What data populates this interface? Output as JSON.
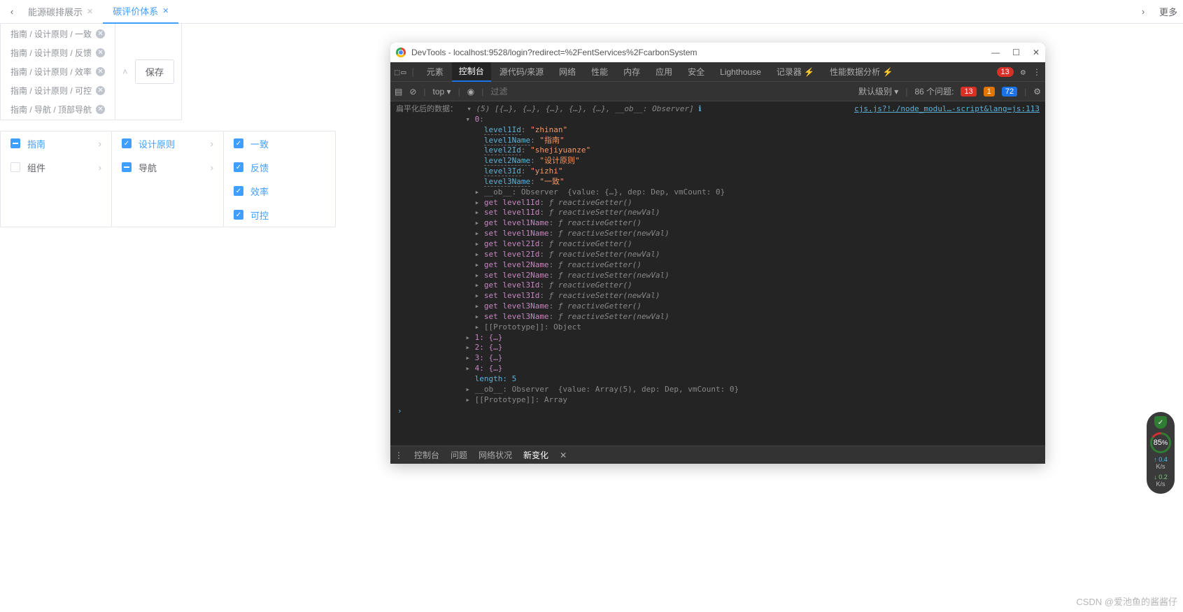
{
  "tabs": {
    "prev": "‹",
    "next": "›",
    "more": "更多",
    "items": [
      {
        "label": "能源碳排展示",
        "active": false
      },
      {
        "label": "碳评价体系",
        "active": true
      }
    ]
  },
  "selectedTags": [
    "指南 / 设计原则 / 一致",
    "指南 / 设计原则 / 反馈",
    "指南 / 设计原则 / 效率",
    "指南 / 设计原则 / 可控",
    "指南 / 导航 / 顶部导航"
  ],
  "saveButton": "保存",
  "cascader": {
    "col1": [
      {
        "label": "指南",
        "state": "indeterminate",
        "arrow": true,
        "active": true
      },
      {
        "label": "组件",
        "state": "none",
        "arrow": true,
        "active": false
      }
    ],
    "col2": [
      {
        "label": "设计原则",
        "state": "checked",
        "arrow": true,
        "active": true
      },
      {
        "label": "导航",
        "state": "indeterminate",
        "arrow": true,
        "active": false
      }
    ],
    "col3": [
      {
        "label": "一致",
        "state": "checked"
      },
      {
        "label": "反馈",
        "state": "checked"
      },
      {
        "label": "效率",
        "state": "checked"
      },
      {
        "label": "可控",
        "state": "checked"
      }
    ]
  },
  "devtools": {
    "title": "DevTools - localhost:9528/login?redirect=%2FentServices%2FcarbonSystem",
    "menuTabs": [
      "元素",
      "控制台",
      "源代码/来源",
      "网络",
      "性能",
      "内存",
      "应用",
      "安全",
      "Lighthouse",
      "记录器 ⚡",
      "性能数据分析 ⚡"
    ],
    "activeMenuTab": "控制台",
    "errorBadge": "13",
    "toolbar": {
      "context": "top ▾",
      "filterPlaceholder": "过滤",
      "level": "默认级别 ▾",
      "issues": "86 个问题:",
      "err": "13",
      "warn": "1",
      "info": "72"
    },
    "sourceLink": "cjs.js?!./node_modul…-script&lang=js:113",
    "consoleLog": {
      "prefix": "扁平化后的数据：",
      "summary": "(5) [{…}, {…}, {…}, {…}, {…}, __ob__: Observer]",
      "obj0": {
        "level1Id": "zhinan",
        "level1Name": "指南",
        "level2Id": "shejiyuanze",
        "level2Name": "设计原则",
        "level3Id": "yizhi",
        "level3Name": "一致"
      },
      "observer": "__ob__: Observer  {value: {…}, dep: Dep, vmCount: 0}",
      "getters": [
        "get level1Id: ƒ reactiveGetter()",
        "set level1Id: ƒ reactiveSetter(newVal)",
        "get level1Name: ƒ reactiveGetter()",
        "set level1Name: ƒ reactiveSetter(newVal)",
        "get level2Id: ƒ reactiveGetter()",
        "set level2Id: ƒ reactiveSetter(newVal)",
        "get level2Name: ƒ reactiveGetter()",
        "set level2Name: ƒ reactiveSetter(newVal)",
        "get level3Id: ƒ reactiveGetter()",
        "set level3Id: ƒ reactiveSetter(newVal)",
        "get level3Name: ƒ reactiveGetter()",
        "set level3Name: ƒ reactiveSetter(newVal)"
      ],
      "proto0": "[[Prototype]]: Object",
      "rest": [
        "1: {…}",
        "2: {…}",
        "3: {…}",
        "4: {…}"
      ],
      "length": "length: 5",
      "obArr": "__ob__: Observer  {value: Array(5), dep: Dep, vmCount: 0}",
      "protoArr": "[[Prototype]]: Array"
    },
    "bottomTabs": [
      "控制台",
      "问题",
      "网络状况",
      "新变化"
    ],
    "activeBottomTab": "新变化"
  },
  "widget": {
    "percent": "85",
    "up": "0.4",
    "upUnit": "K/s",
    "dn": "0.2",
    "dnUnit": "K/s"
  },
  "watermark": "CSDN @爱池鱼的酱酱仔"
}
